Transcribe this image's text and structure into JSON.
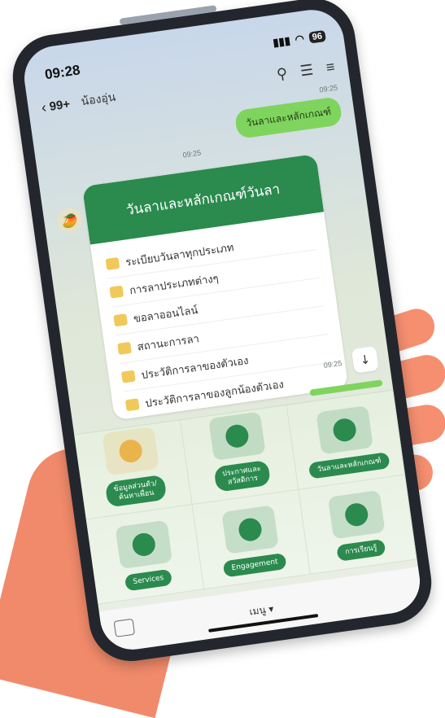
{
  "status_bar": {
    "time": "09:28",
    "battery": "96"
  },
  "chat_header": {
    "back_count": "99+",
    "contact_name": "น้องอุ่น"
  },
  "messages": {
    "sent_time": "09:25",
    "sent_text": "วันลาและหลักเกณฑ์",
    "reply_time": "09:25",
    "card_title": "วันลาและหลักเกณฑ์วันลา",
    "card_items": [
      "ระเบียบวันลาทุกประเภท",
      "การลาประเภทต่างๆ",
      "ขอลาออนไลน์",
      "สถานะการลา",
      "ประวัติการลาของตัวเอง",
      "ประวัติการลาของลูกน้องตัวเอง"
    ],
    "card_time": "09:25"
  },
  "rich_menu": [
    {
      "label": "ข้อมูลส่วนตัว/\nค้นหาเพื่อน",
      "icon": "mascot-icon",
      "color": "#e9b44c"
    },
    {
      "label": "ประกาศและ\nสวัสดิการ",
      "icon": "person-network-icon",
      "color": "#2b8a4e"
    },
    {
      "label": "วันลาและหลักเกณฑ์",
      "icon": "calendar-icon",
      "color": "#2b8a4e"
    },
    {
      "label": "Services",
      "icon": "tools-icon",
      "color": "#2b8a4e"
    },
    {
      "label": "Engagement",
      "icon": "thumbs-up-icon",
      "color": "#2b8a4e"
    },
    {
      "label": "การเรียนรู้",
      "icon": "presentation-icon",
      "color": "#2b8a4e"
    }
  ],
  "bottom_bar": {
    "menu_label": "เมนู ▾"
  }
}
